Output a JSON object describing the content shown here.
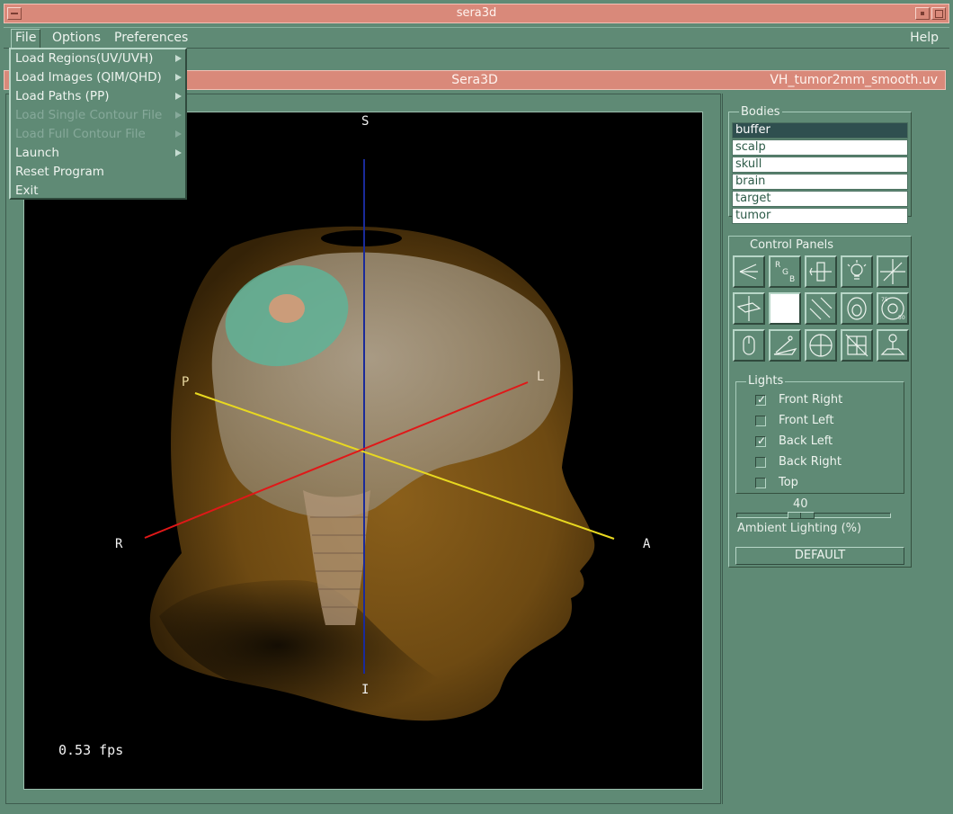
{
  "window": {
    "title": "sera3d"
  },
  "menubar": {
    "items": [
      {
        "label": "File"
      },
      {
        "label": "Options"
      },
      {
        "label": "Preferences"
      }
    ],
    "help": "Help"
  },
  "file_menu": {
    "items": [
      {
        "label": "Load Regions(UV/UVH)",
        "submenu": true,
        "enabled": true
      },
      {
        "label": "Load Images (QIM/QHD)",
        "submenu": true,
        "enabled": true
      },
      {
        "label": "Load Paths (PP)",
        "submenu": true,
        "enabled": true
      },
      {
        "label": "Load Single Contour File",
        "submenu": true,
        "enabled": false
      },
      {
        "label": "Load Full Contour File",
        "submenu": true,
        "enabled": false
      },
      {
        "label": "Launch",
        "submenu": true,
        "enabled": true
      },
      {
        "label": "Reset Program",
        "submenu": false,
        "enabled": true
      },
      {
        "label": "Exit",
        "submenu": false,
        "enabled": true
      }
    ]
  },
  "header": {
    "center": "Sera3D",
    "filename": "VH_tumor2mm_smooth.uv"
  },
  "viewport": {
    "labels": {
      "superior": "S",
      "inferior": "I",
      "posterior": "P",
      "left": "L",
      "right": "R",
      "anterior": "A"
    },
    "fps": "0.53 fps",
    "colors": {
      "background": "#000000",
      "axis_si": "#1a2a9a",
      "axis_rl": "#e01818",
      "axis_pa": "#e8d820"
    }
  },
  "bodies": {
    "title": "Bodies",
    "items": [
      "buffer",
      "scalp",
      "skull",
      "brain",
      "target",
      "tumor"
    ],
    "selected": "buffer"
  },
  "control_panels": {
    "title": "Control Panels",
    "icons": [
      "axis-view-icon",
      "rgb-color-icon",
      "clipping-plane-icon",
      "light-bulb-icon",
      "crosshair-axes-icon",
      "slice-plane-icon",
      "blank-panel-icon",
      "arrows-icon",
      "head-outline-icon",
      "rotation-angles-icon",
      "mouse-icon",
      "camera-path-icon",
      "target-circle-icon",
      "grid-pointer-icon",
      "beam-icon"
    ]
  },
  "lights": {
    "title": "Lights",
    "items": [
      {
        "label": "Front Right",
        "checked": true
      },
      {
        "label": "Front Left",
        "checked": false
      },
      {
        "label": "Back Left",
        "checked": true
      },
      {
        "label": "Back Right",
        "checked": false
      },
      {
        "label": "Top",
        "checked": false
      }
    ]
  },
  "ambient": {
    "value": "40",
    "label": "Ambient Lighting (%)",
    "fraction": 0.4
  },
  "default_button": "DEFAULT",
  "theme": {
    "panel": "#5f8a75",
    "title": "#d9897a",
    "list_selected": "#2f4f4f"
  }
}
